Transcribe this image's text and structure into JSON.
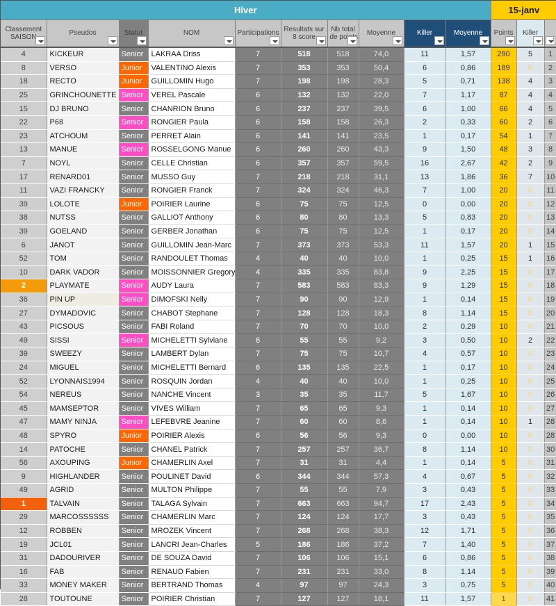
{
  "banner": {
    "season_label": "Hiver",
    "date_label": "15-janv"
  },
  "colors": {
    "banner_teal": "#4bacc6",
    "banner_gold": "#ffcc00",
    "header_navy": "#1f4e79",
    "statut_senior_male": "#808080",
    "statut_senior_female": "#ff4ec4",
    "statut_junior": "#ff6600",
    "rank_first": "#f4610c",
    "rank_second": "#f49b0c",
    "points_gold": "#ffcc00",
    "killer_lightblue": "#dceaf2"
  },
  "columns": [
    {
      "label": "Classement SAISON",
      "line1": "Classement",
      "line2": "SAISON",
      "name": "classement-saison"
    },
    {
      "label": "Pseudos",
      "line1": "Pseudos",
      "line2": "",
      "name": "pseudos"
    },
    {
      "label": "Statut",
      "line1": "Statut",
      "line2": "",
      "name": "statut"
    },
    {
      "label": "NOM",
      "line1": "NOM",
      "line2": "",
      "name": "nom"
    },
    {
      "label": "Participations",
      "line1": "Participations",
      "line2": "",
      "name": "participations"
    },
    {
      "label": "Resultats sur 8 score",
      "line1": "Resultats sur",
      "line2": "8 score",
      "name": "resultats-sur-8-score"
    },
    {
      "label": "Nb total de points",
      "line1": "Nb total",
      "line2": "de points",
      "name": "nb-total-de-points"
    },
    {
      "label": "Moyenne",
      "line1": "Moyenne",
      "line2": "",
      "name": "moyenne-points"
    },
    {
      "label": "Killer",
      "line1": "Killer",
      "line2": "",
      "name": "killer-total"
    },
    {
      "label": "Moyenne",
      "line1": "Moyenne",
      "line2": "",
      "name": "moyenne-killer"
    },
    {
      "label": "Points",
      "line1": "Points",
      "line2": "",
      "name": "points"
    },
    {
      "label": "Killer",
      "line1": "Killer",
      "line2": "",
      "name": "killer-jour"
    },
    {
      "label": "",
      "line1": "",
      "line2": "",
      "name": "rang-jour"
    }
  ],
  "rows": [
    {
      "rank": "4",
      "pseudo": "KICKEUR",
      "statut": "Senior",
      "sex": "m",
      "nom": "LAKRAA Driss",
      "part": "7",
      "res8": "518",
      "nbtot": "518",
      "moy1": "74,0",
      "killer1": "11",
      "moy2": "1,57",
      "points": "290",
      "killer2": "5",
      "idx": "1"
    },
    {
      "rank": "8",
      "pseudo": "VERSO",
      "statut": "Junior",
      "sex": "j",
      "nom": "VALENTINO Alexis",
      "part": "7",
      "res8": "353",
      "nbtot": "353",
      "moy1": "50,4",
      "killer1": "6",
      "moy2": "0,86",
      "points": "189",
      "killer2": "0",
      "idx": "2"
    },
    {
      "rank": "18",
      "pseudo": "RECTO",
      "statut": "Junior",
      "sex": "j",
      "nom": "GUILLOMIN Hugo",
      "part": "7",
      "res8": "198",
      "nbtot": "198",
      "moy1": "28,3",
      "killer1": "5",
      "moy2": "0,71",
      "points": "138",
      "killer2": "4",
      "idx": "3"
    },
    {
      "rank": "25",
      "pseudo": "GRINCHOUNETTE",
      "statut": "Senior",
      "sex": "f",
      "nom": "VEREL Pascale",
      "part": "6",
      "res8": "132",
      "nbtot": "132",
      "moy1": "22,0",
      "killer1": "7",
      "moy2": "1,17",
      "points": "87",
      "killer2": "4",
      "idx": "4"
    },
    {
      "rank": "15",
      "pseudo": "DJ BRUNO",
      "statut": "Senior",
      "sex": "m",
      "nom": "CHANRION Bruno",
      "part": "6",
      "res8": "237",
      "nbtot": "237",
      "moy1": "39,5",
      "killer1": "6",
      "moy2": "1,00",
      "points": "66",
      "killer2": "4",
      "idx": "5"
    },
    {
      "rank": "22",
      "pseudo": "P68",
      "statut": "Senior",
      "sex": "f",
      "nom": "RONGIER Paula",
      "part": "6",
      "res8": "158",
      "nbtot": "158",
      "moy1": "26,3",
      "killer1": "2",
      "moy2": "0,33",
      "points": "60",
      "killer2": "2",
      "idx": "6"
    },
    {
      "rank": "23",
      "pseudo": "ATCHOUM",
      "statut": "Senior",
      "sex": "m",
      "nom": "PERRET Alain",
      "part": "6",
      "res8": "141",
      "nbtot": "141",
      "moy1": "23,5",
      "killer1": "1",
      "moy2": "0,17",
      "points": "54",
      "killer2": "1",
      "idx": "7"
    },
    {
      "rank": "13",
      "pseudo": "MANUE",
      "statut": "Senior",
      "sex": "f",
      "nom": "ROSSELGONG Manue",
      "part": "6",
      "res8": "260",
      "nbtot": "260",
      "moy1": "43,3",
      "killer1": "9",
      "moy2": "1,50",
      "points": "48",
      "killer2": "3",
      "idx": "8"
    },
    {
      "rank": "7",
      "pseudo": "NOYL",
      "statut": "Senior",
      "sex": "m",
      "nom": "CELLE Christian",
      "part": "6",
      "res8": "357",
      "nbtot": "357",
      "moy1": "59,5",
      "killer1": "16",
      "moy2": "2,67",
      "points": "42",
      "killer2": "2",
      "idx": "9"
    },
    {
      "rank": "17",
      "pseudo": "RENARD01",
      "statut": "Senior",
      "sex": "m",
      "nom": "MUSSO Guy",
      "part": "7",
      "res8": "218",
      "nbtot": "218",
      "moy1": "31,1",
      "killer1": "13",
      "moy2": "1,86",
      "points": "36",
      "killer2": "7",
      "idx": "10"
    },
    {
      "rank": "11",
      "pseudo": "VAZI FRANCKY",
      "statut": "Senior",
      "sex": "m",
      "nom": "RONGIER Franck",
      "part": "7",
      "res8": "324",
      "nbtot": "324",
      "moy1": "46,3",
      "killer1": "7",
      "moy2": "1,00",
      "points": "20",
      "killer2": "0",
      "idx": "11"
    },
    {
      "rank": "39",
      "pseudo": "LOLOTE",
      "statut": "Junior",
      "sex": "j",
      "nom": "POIRIER Laurine",
      "part": "6",
      "res8": "75",
      "nbtot": "75",
      "moy1": "12,5",
      "killer1": "0",
      "moy2": "0,00",
      "points": "20",
      "killer2": "0",
      "idx": "12"
    },
    {
      "rank": "38",
      "pseudo": "NUTSS",
      "statut": "Senior",
      "sex": "m",
      "nom": "GALLIOT Anthony",
      "part": "6",
      "res8": "80",
      "nbtot": "80",
      "moy1": "13,3",
      "killer1": "5",
      "moy2": "0,83",
      "points": "20",
      "killer2": "0",
      "idx": "13"
    },
    {
      "rank": "39",
      "pseudo": "GOELAND",
      "statut": "Senior",
      "sex": "m",
      "nom": "GERBER Jonathan",
      "part": "6",
      "res8": "75",
      "nbtot": "75",
      "moy1": "12,5",
      "killer1": "1",
      "moy2": "0,17",
      "points": "20",
      "killer2": "0",
      "idx": "14"
    },
    {
      "rank": "6",
      "pseudo": "JANOT",
      "statut": "Senior",
      "sex": "m",
      "nom": "GUILLOMIN Jean-Marc",
      "part": "7",
      "res8": "373",
      "nbtot": "373",
      "moy1": "53,3",
      "killer1": "11",
      "moy2": "1,57",
      "points": "20",
      "killer2": "1",
      "idx": "15"
    },
    {
      "rank": "52",
      "pseudo": "TOM",
      "statut": "Senior",
      "sex": "m",
      "nom": "RANDOULET Thomas",
      "part": "4",
      "res8": "40",
      "nbtot": "40",
      "moy1": "10,0",
      "killer1": "1",
      "moy2": "0,25",
      "points": "15",
      "killer2": "1",
      "idx": "16"
    },
    {
      "rank": "10",
      "pseudo": "DARK VADOR",
      "statut": "Senior",
      "sex": "m",
      "nom": "MOISSONNIER Gregory",
      "part": "4",
      "res8": "335",
      "nbtot": "335",
      "moy1": "83,8",
      "killer1": "9",
      "moy2": "2,25",
      "points": "15",
      "killer2": "0",
      "idx": "17"
    },
    {
      "rank": "2",
      "pseudo": "PLAYMATE",
      "statut": "Senior",
      "sex": "f",
      "nom": "AUDY Laura",
      "part": "7",
      "res8": "583",
      "nbtot": "583",
      "moy1": "83,3",
      "killer1": "9",
      "moy2": "1,29",
      "points": "15",
      "killer2": "0",
      "idx": "18"
    },
    {
      "rank": "36",
      "pseudo": "PIN UP",
      "statut": "Senior",
      "sex": "f",
      "nom": "DIMOFSKI Nelly",
      "part": "7",
      "res8": "90",
      "nbtot": "90",
      "moy1": "12,9",
      "killer1": "1",
      "moy2": "0,14",
      "points": "15",
      "killer2": "0",
      "idx": "19"
    },
    {
      "rank": "27",
      "pseudo": "DYMADOVIC",
      "statut": "Senior",
      "sex": "m",
      "nom": "CHABOT Stephane",
      "part": "7",
      "res8": "128",
      "nbtot": "128",
      "moy1": "18,3",
      "killer1": "8",
      "moy2": "1,14",
      "points": "15",
      "killer2": "0",
      "idx": "20"
    },
    {
      "rank": "43",
      "pseudo": "PICSOUS",
      "statut": "Senior",
      "sex": "m",
      "nom": "FABI Roland",
      "part": "7",
      "res8": "70",
      "nbtot": "70",
      "moy1": "10,0",
      "killer1": "2",
      "moy2": "0,29",
      "points": "10",
      "killer2": "0",
      "idx": "21"
    },
    {
      "rank": "49",
      "pseudo": "SISSI",
      "statut": "Senior",
      "sex": "f",
      "nom": "MICHELETTI Sylviane",
      "part": "6",
      "res8": "55",
      "nbtot": "55",
      "moy1": "9,2",
      "killer1": "3",
      "moy2": "0,50",
      "points": "10",
      "killer2": "2",
      "idx": "22"
    },
    {
      "rank": "39",
      "pseudo": "SWEEZY",
      "statut": "Senior",
      "sex": "m",
      "nom": "LAMBERT Dylan",
      "part": "7",
      "res8": "75",
      "nbtot": "75",
      "moy1": "10,7",
      "killer1": "4",
      "moy2": "0,57",
      "points": "10",
      "killer2": "0",
      "idx": "23"
    },
    {
      "rank": "24",
      "pseudo": "MIGUEL",
      "statut": "Senior",
      "sex": "m",
      "nom": "MICHELETTI Bernard",
      "part": "6",
      "res8": "135",
      "nbtot": "135",
      "moy1": "22,5",
      "killer1": "1",
      "moy2": "0,17",
      "points": "10",
      "killer2": "0",
      "idx": "24"
    },
    {
      "rank": "52",
      "pseudo": "LYONNAIS1994",
      "statut": "Senior",
      "sex": "m",
      "nom": "ROSQUIN Jordan",
      "part": "4",
      "res8": "40",
      "nbtot": "40",
      "moy1": "10,0",
      "killer1": "1",
      "moy2": "0,25",
      "points": "10",
      "killer2": "0",
      "idx": "25"
    },
    {
      "rank": "54",
      "pseudo": "NEREUS",
      "statut": "Senior",
      "sex": "m",
      "nom": "NANCHE Vincent",
      "part": "3",
      "res8": "35",
      "nbtot": "35",
      "moy1": "11,7",
      "killer1": "5",
      "moy2": "1,67",
      "points": "10",
      "killer2": "0",
      "idx": "26"
    },
    {
      "rank": "45",
      "pseudo": "MAMSEPTOR",
      "statut": "Senior",
      "sex": "m",
      "nom": "VIVES William",
      "part": "7",
      "res8": "65",
      "nbtot": "65",
      "moy1": "9,3",
      "killer1": "1",
      "moy2": "0,14",
      "points": "10",
      "killer2": "0",
      "idx": "27"
    },
    {
      "rank": "47",
      "pseudo": "MAMY NINJA",
      "statut": "Senior",
      "sex": "f",
      "nom": "LEFEBVRE Jeanine",
      "part": "7",
      "res8": "60",
      "nbtot": "60",
      "moy1": "8,6",
      "killer1": "1",
      "moy2": "0,14",
      "points": "10",
      "killer2": "1",
      "idx": "28"
    },
    {
      "rank": "48",
      "pseudo": "SPYRO",
      "statut": "Junior",
      "sex": "j",
      "nom": "POIRIER Alexis",
      "part": "6",
      "res8": "56",
      "nbtot": "56",
      "moy1": "9,3",
      "killer1": "0",
      "moy2": "0,00",
      "points": "10",
      "killer2": "0",
      "idx": "28"
    },
    {
      "rank": "14",
      "pseudo": "PATOCHE",
      "statut": "Senior",
      "sex": "m",
      "nom": "CHANEL Patrick",
      "part": "7",
      "res8": "257",
      "nbtot": "257",
      "moy1": "36,7",
      "killer1": "8",
      "moy2": "1,14",
      "points": "10",
      "killer2": "0",
      "idx": "30"
    },
    {
      "rank": "56",
      "pseudo": "AXOUPING",
      "statut": "Junior",
      "sex": "j",
      "nom": "CHAMERLIN Axel",
      "part": "7",
      "res8": "31",
      "nbtot": "31",
      "moy1": "4,4",
      "killer1": "1",
      "moy2": "0,14",
      "points": "5",
      "killer2": "0",
      "idx": "31"
    },
    {
      "rank": "9",
      "pseudo": "HIGHLANDER",
      "statut": "Senior",
      "sex": "m",
      "nom": "POULINET David",
      "part": "6",
      "res8": "344",
      "nbtot": "344",
      "moy1": "57,3",
      "killer1": "4",
      "moy2": "0,67",
      "points": "5",
      "killer2": "0",
      "idx": "32"
    },
    {
      "rank": "49",
      "pseudo": "AGRID",
      "statut": "Senior",
      "sex": "m",
      "nom": "MULTON Philippe",
      "part": "7",
      "res8": "55",
      "nbtot": "55",
      "moy1": "7,9",
      "killer1": "3",
      "moy2": "0,43",
      "points": "5",
      "killer2": "0",
      "idx": "33"
    },
    {
      "rank": "1",
      "pseudo": "TALVAIN",
      "statut": "Senior",
      "sex": "m",
      "nom": "TALAGA Sylvain",
      "part": "7",
      "res8": "663",
      "nbtot": "663",
      "moy1": "94,7",
      "killer1": "17",
      "moy2": "2,43",
      "points": "5",
      "killer2": "0",
      "idx": "34"
    },
    {
      "rank": "29",
      "pseudo": "MARCOSSSSSS",
      "statut": "Senior",
      "sex": "m",
      "nom": "CHAMERLIN Marc",
      "part": "7",
      "res8": "124",
      "nbtot": "124",
      "moy1": "17,7",
      "killer1": "3",
      "moy2": "0,43",
      "points": "5",
      "killer2": "0",
      "idx": "35"
    },
    {
      "rank": "12",
      "pseudo": "ROBBEN",
      "statut": "Senior",
      "sex": "m",
      "nom": "MROZEK Vincent",
      "part": "7",
      "res8": "268",
      "nbtot": "268",
      "moy1": "38,3",
      "killer1": "12",
      "moy2": "1,71",
      "points": "5",
      "killer2": "0",
      "idx": "36"
    },
    {
      "rank": "19",
      "pseudo": "JCL01",
      "statut": "Senior",
      "sex": "m",
      "nom": "LANCRI Jean-Charles",
      "part": "5",
      "res8": "186",
      "nbtot": "186",
      "moy1": "37,2",
      "killer1": "7",
      "moy2": "1,40",
      "points": "5",
      "killer2": "0",
      "idx": "37"
    },
    {
      "rank": "31",
      "pseudo": "DADOURIVER",
      "statut": "Senior",
      "sex": "m",
      "nom": "DE SOUZA David",
      "part": "7",
      "res8": "106",
      "nbtot": "106",
      "moy1": "15,1",
      "killer1": "6",
      "moy2": "0,86",
      "points": "5",
      "killer2": "0",
      "idx": "38"
    },
    {
      "rank": "16",
      "pseudo": "FAB",
      "statut": "Senior",
      "sex": "m",
      "nom": "RENAUD Fabien",
      "part": "7",
      "res8": "231",
      "nbtot": "231",
      "moy1": "33,0",
      "killer1": "8",
      "moy2": "1,14",
      "points": "5",
      "killer2": "0",
      "idx": "39"
    },
    {
      "rank": "33",
      "pseudo": "MONEY MAKER",
      "statut": "Senior",
      "sex": "m",
      "nom": "BERTRAND Thomas",
      "part": "4",
      "res8": "97",
      "nbtot": "97",
      "moy1": "24,3",
      "killer1": "3",
      "moy2": "0,75",
      "points": "5",
      "killer2": "0",
      "idx": "40"
    },
    {
      "rank": "28",
      "pseudo": "TOUTOUNE",
      "statut": "Senior",
      "sex": "m",
      "nom": "POIRIER Christian",
      "part": "7",
      "res8": "127",
      "nbtot": "127",
      "moy1": "18,1",
      "killer1": "11",
      "moy2": "1,57",
      "points": "1",
      "killer2": "0",
      "idx": "41"
    }
  ]
}
